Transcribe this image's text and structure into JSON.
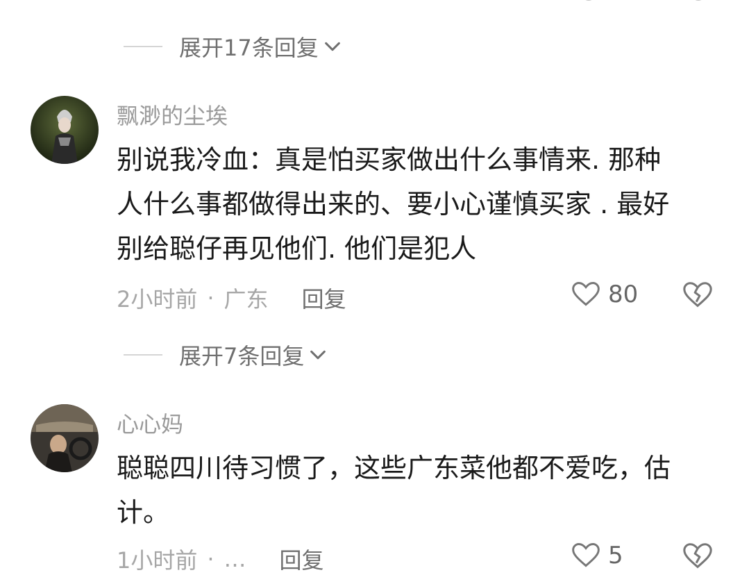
{
  "replies_expand": [
    {
      "label": "展开17条回复"
    },
    {
      "label": "展开7条回复"
    }
  ],
  "comments": [
    {
      "username": "飘渺的尘埃",
      "text_lines": [
        "别说我冷血：真是怕买家做出什么事情来. 那种",
        "人什么事都做得出来的、要小心谨慎买家 . 最好",
        "别给聪仔再见他们. 他们是犯人"
      ],
      "time": "2小时前",
      "separator": "·",
      "location": "广东",
      "reply": "回复",
      "likes": "80"
    },
    {
      "username": "心心妈",
      "text_lines": [
        "聪聪四川待习惯了，这些广东菜他都不爱吃，估",
        "计。"
      ],
      "time": "1小时前",
      "separator": "·",
      "location": "… ",
      "reply": "回复",
      "likes": "5"
    }
  ],
  "icons": {
    "like": "heart-outline-icon",
    "dislike": "broken-heart-icon",
    "expand": "chevron-down-icon"
  }
}
